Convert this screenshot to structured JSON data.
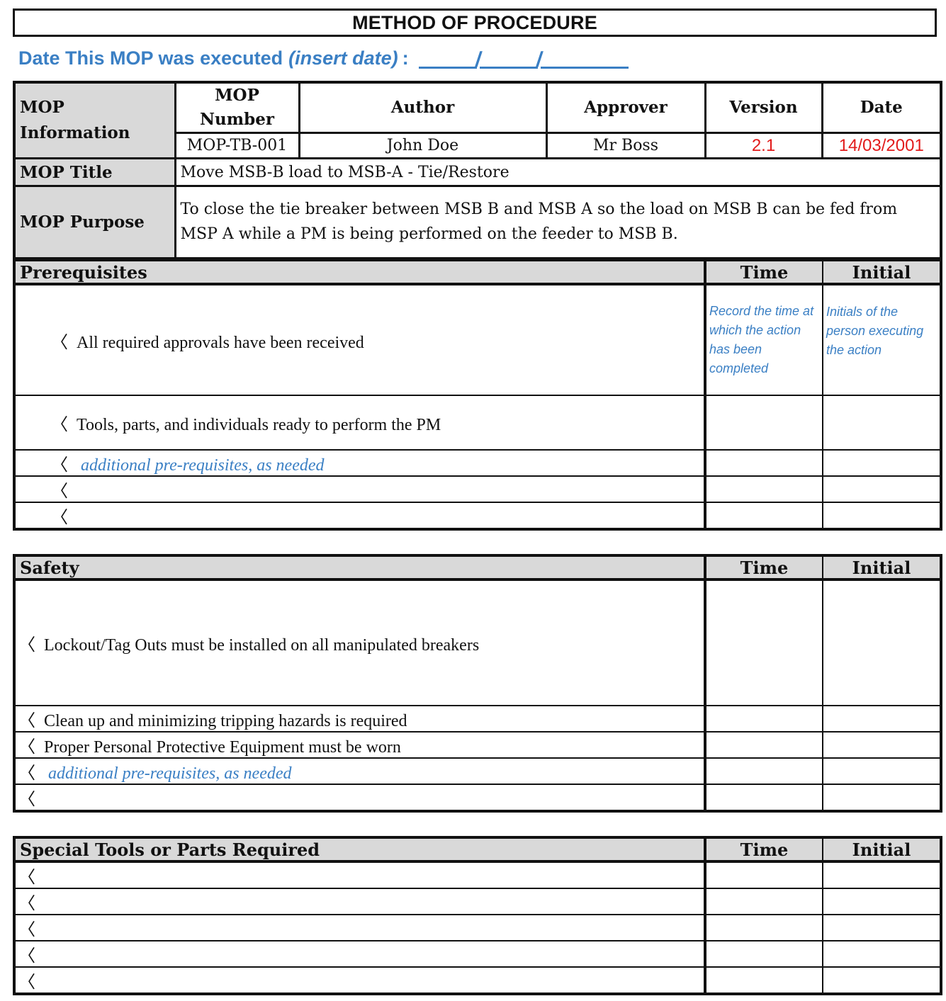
{
  "header": {
    "title": "METHOD OF PROCEDURE",
    "date_label": "Date This MOP was executed",
    "date_hint": "(insert date)",
    "date_colon": ":",
    "date_separator": "/"
  },
  "info": {
    "section_label": "MOP Information",
    "columns": [
      "MOP Number",
      "Author",
      "Approver",
      "Version",
      "Date"
    ],
    "values": {
      "mop_number": "MOP-TB-001",
      "author": "John Doe",
      "approver": "Mr Boss",
      "version": "2.1",
      "date": "14/03/2001"
    },
    "title_label": "MOP Title",
    "title_value": "Move MSB-B load to MSB-A - Tie/Restore",
    "purpose_label": "MOP Purpose",
    "purpose_value": "To close the tie breaker between MSB B and MSB A so the load on MSB B can be fed from MSP A while a PM is being performed on the feeder to MSB B.",
    "accent_red": "#e21b1b"
  },
  "colors": {
    "accent_blue": "#3a7fc4",
    "header_gray": "#d9d9d9"
  },
  "bullet": "〈",
  "prerequisites": {
    "title": "Prerequisites",
    "time_label": "Time",
    "initial_label": "Initial",
    "time_hint": "Record the time at which the action has been completed",
    "initial_hint": "Initials of the person executing the action",
    "items": [
      "All required approvals have been received",
      "Tools, parts, and individuals ready to perform the PM",
      "additional pre-requisites, as needed",
      "",
      ""
    ]
  },
  "safety": {
    "title": "Safety",
    "time_label": "Time",
    "initial_label": "Initial",
    "items": [
      "Lockout/Tag Outs must be installed on all manipulated breakers",
      "Clean up and minimizing tripping hazards is required",
      "Proper Personal Protective Equipment must be worn",
      "additional pre-requisites, as needed",
      ""
    ]
  },
  "tools": {
    "title": "Special Tools or Parts Required",
    "time_label": "Time",
    "initial_label": "Initial",
    "items": [
      "",
      "",
      "",
      "",
      ""
    ]
  }
}
